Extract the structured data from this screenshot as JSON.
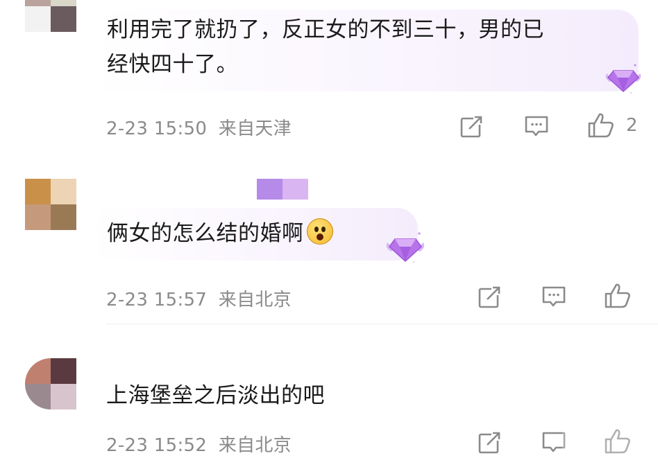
{
  "comments": [
    {
      "text_line1": "利用完了就扔了，反正女的不到三十，男的已",
      "text_line2": "经快四十了。",
      "timestamp": "2-23 15:50",
      "location": "来自天津",
      "like_count": "2",
      "avatar_colors": [
        "#b9a39c",
        "#d9d7c8",
        "#f2f2f2",
        "#6b5a5e"
      ]
    },
    {
      "text": "俩女的怎么结的婚啊",
      "emoji": "astonished-face",
      "timestamp": "2-23 15:57",
      "location": "来自北京",
      "avatar_colors": [
        "#c9904a",
        "#ecd4b4",
        "#c59a7c",
        "#9a7a55"
      ],
      "name_colors": [
        "#b58ae8",
        "#d9b6f2"
      ]
    },
    {
      "text": "上海堡垒之后淡出的吧",
      "timestamp": "2-23 15:52",
      "location": "来自北京",
      "avatar_colors": [
        "#c08070",
        "#5a3a40",
        "#9a8a90",
        "#d8c4cc"
      ]
    }
  ],
  "colors": {
    "meta_gray": "#8a8a8a",
    "badge_purple": "#a763e0"
  }
}
